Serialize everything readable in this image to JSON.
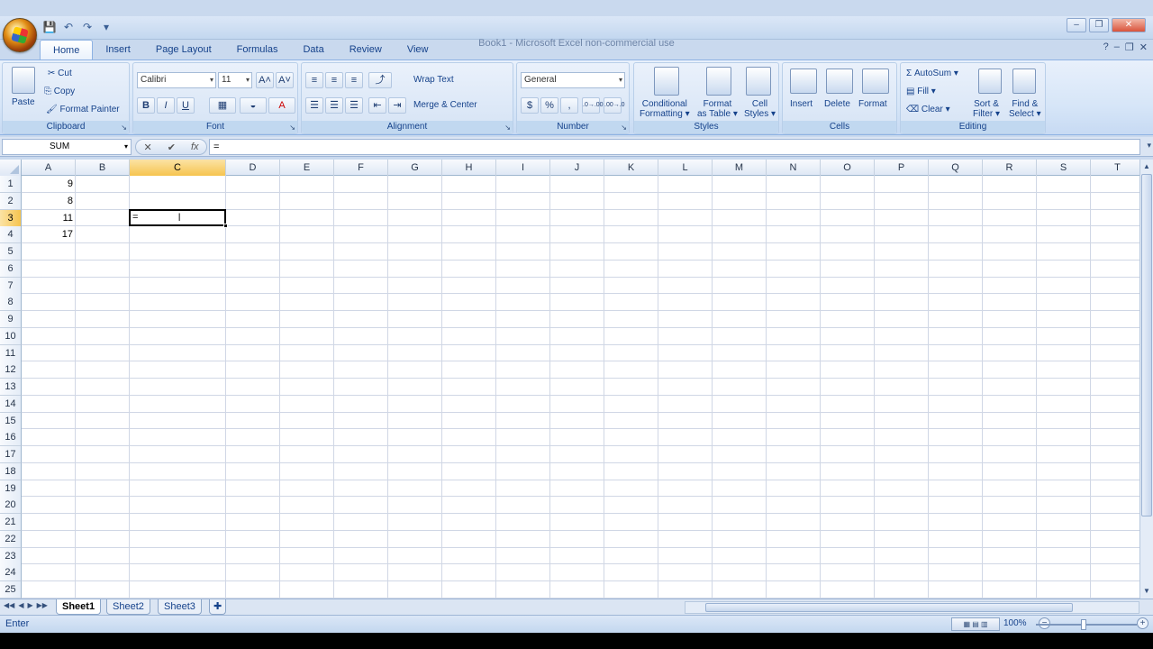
{
  "window": {
    "title": "Book1 - Microsoft Excel non-commercial use",
    "controls": [
      "–",
      "❐",
      "✕"
    ]
  },
  "qat": [
    "💾",
    "↶",
    "↷",
    "▾"
  ],
  "tabs": [
    {
      "label": "Home",
      "active": true
    },
    {
      "label": "Insert"
    },
    {
      "label": "Page Layout"
    },
    {
      "label": "Formulas"
    },
    {
      "label": "Data"
    },
    {
      "label": "Review"
    },
    {
      "label": "View"
    }
  ],
  "help": {
    "help": "?",
    "min": "–",
    "restore": "❐",
    "close": "✕"
  },
  "ribbon": {
    "clipboard": {
      "label": "Clipboard",
      "paste": "Paste",
      "cut": "Cut",
      "copy": "Copy",
      "format_painter": "Format Painter"
    },
    "font": {
      "label": "Font",
      "family": "Calibri",
      "size": "11",
      "bold": "B",
      "italic": "I",
      "underline": "U",
      "grow": "A˄",
      "shrink": "A˅",
      "border": "▦",
      "fill": "◒",
      "color": "A"
    },
    "alignment": {
      "label": "Alignment",
      "wrap": "Wrap Text",
      "merge": "Merge & Center"
    },
    "number": {
      "label": "Number",
      "format": "General",
      "currency": "$",
      "percent": "%",
      "comma": ",",
      "inc": ".0→.00",
      "dec": ".00→.0"
    },
    "styles": {
      "label": "Styles",
      "conditional": [
        "Conditional",
        "Formatting ▾"
      ],
      "format_table": [
        "Format",
        "as Table ▾"
      ],
      "cell_styles": [
        "Cell",
        "Styles ▾"
      ]
    },
    "cells": {
      "label": "Cells",
      "insert": "Insert",
      "delete": "Delete",
      "format": "Format"
    },
    "editing": {
      "label": "Editing",
      "autosum": "AutoSum ▾",
      "fill": "Fill ▾",
      "clear": "Clear ▾",
      "sort": [
        "Sort &",
        "Filter ▾"
      ],
      "find": [
        "Find &",
        "Select ▾"
      ]
    }
  },
  "formula_bar": {
    "name_box": "SUM",
    "cancel": "✕",
    "enter": "✔",
    "fx": "fx",
    "formula": "="
  },
  "columns": [
    "A",
    "B",
    "C",
    "D",
    "E",
    "F",
    "G",
    "H",
    "I",
    "J",
    "K",
    "L",
    "M",
    "N",
    "O",
    "P",
    "Q",
    "R",
    "S",
    "T"
  ],
  "selected_column": "C",
  "rows": [
    "1",
    "2",
    "3",
    "4",
    "5",
    "6",
    "7",
    "8",
    "9",
    "10",
    "11",
    "12",
    "13",
    "14",
    "15",
    "16",
    "17",
    "18",
    "19",
    "20",
    "21",
    "22",
    "23",
    "24",
    "25"
  ],
  "selected_row": "3",
  "cells": {
    "A1": "9",
    "A2": "8",
    "A3": "11",
    "A4": "17"
  },
  "active_cell": {
    "ref": "C3",
    "content": "="
  },
  "sheets": [
    {
      "label": "Sheet1",
      "active": true
    },
    {
      "label": "Sheet2"
    },
    {
      "label": "Sheet3"
    }
  ],
  "sheet_nav": [
    "◀◀",
    "◀",
    "▶",
    "▶▶"
  ],
  "status": {
    "mode": "Enter",
    "zoom": "100%"
  }
}
